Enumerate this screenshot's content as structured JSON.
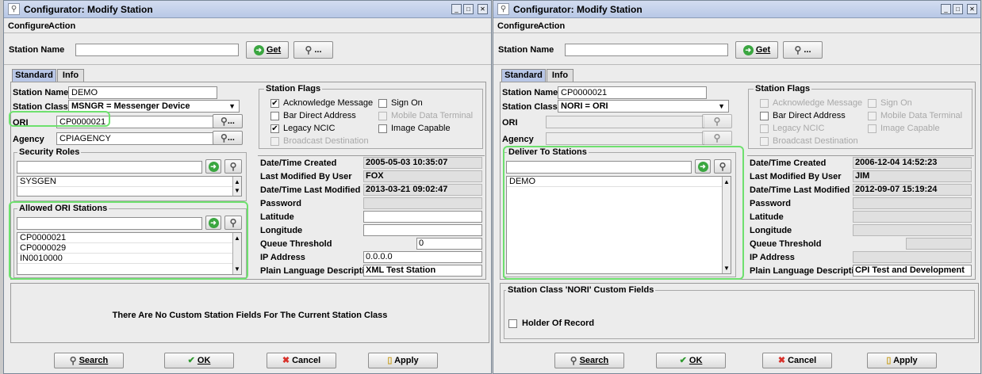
{
  "left": {
    "title": "Configurator: Modify Station",
    "menu": {
      "configure": "Configure",
      "action": "Action"
    },
    "search": {
      "label": "Station Name",
      "value": "",
      "get_label": "Get",
      "browse_label": "..."
    },
    "tabs": {
      "standard": "Standard",
      "info": "Info"
    },
    "form": {
      "station_name_label": "Station Name",
      "station_name_value": "DEMO",
      "station_class_label": "Station Class",
      "station_class_value": "MSNGR = Messenger Device",
      "ori_label": "ORI",
      "ori_value": "CP0000021",
      "agency_label": "Agency",
      "agency_value": "CPIAGENCY",
      "browse_label": "..."
    },
    "security": {
      "title": "Security Roles",
      "input": "",
      "items": [
        "SYSGEN"
      ]
    },
    "allowed": {
      "title": "Allowed ORI Stations",
      "input": "",
      "items": [
        "CP0000021",
        "CP0000029",
        "IN0010000"
      ]
    },
    "flags": {
      "title": "Station Flags",
      "ack": "Acknowledge Message",
      "ack_checked": "✔",
      "bar": "Bar Direct Address",
      "bar_checked": "",
      "legacy": "Legacy NCIC",
      "legacy_checked": "✔",
      "broadcast": "Broadcast Destination",
      "signon": "Sign On",
      "signon_checked": "",
      "mdt": "Mobile Data Terminal",
      "image": "Image Capable",
      "image_checked": ""
    },
    "info": [
      {
        "key": "Date/Time Created",
        "value": "2005-05-03 10:35:07"
      },
      {
        "key": "Last Modified By User",
        "value": "FOX"
      },
      {
        "key": "Date/Time Last Modified",
        "value": "2013-03-21 09:02:47"
      },
      {
        "key": "Password",
        "value": ""
      },
      {
        "key": "Latitude",
        "value": ""
      },
      {
        "key": "Longitude",
        "value": ""
      },
      {
        "key": "Queue Threshold",
        "value": "0"
      },
      {
        "key": "IP Address",
        "value": "0.0.0.0"
      },
      {
        "key": "Plain Language Description",
        "value": "XML Test Station"
      }
    ],
    "custom_message": "There Are No Custom Station Fields For The Current Station Class",
    "buttons": {
      "search": "Search",
      "ok": "OK",
      "cancel": "Cancel",
      "apply": "Apply"
    }
  },
  "right": {
    "title": "Configurator: Modify Station",
    "menu": {
      "configure": "Configure",
      "action": "Action"
    },
    "search": {
      "label": "Station Name",
      "value": "",
      "get_label": "Get",
      "browse_label": "..."
    },
    "tabs": {
      "standard": "Standard",
      "info": "Info"
    },
    "form": {
      "station_name_label": "Station Name",
      "station_name_value": "CP0000021",
      "station_class_label": "Station Class",
      "station_class_value": "NORI = ORI",
      "ori_label": "ORI",
      "ori_value": "",
      "agency_label": "Agency",
      "agency_value": ""
    },
    "deliver": {
      "title": "Deliver To Stations",
      "input": "",
      "items": [
        "DEMO"
      ]
    },
    "flags": {
      "title": "Station Flags",
      "ack": "Acknowledge Message",
      "bar": "Bar Direct Address",
      "bar_checked": "",
      "legacy": "Legacy NCIC",
      "broadcast": "Broadcast Destination",
      "signon": "Sign On",
      "mdt": "Mobile Data Terminal",
      "image": "Image Capable"
    },
    "info": [
      {
        "key": "Date/Time Created",
        "value": "2006-12-04 14:52:23"
      },
      {
        "key": "Last Modified By User",
        "value": "JIM"
      },
      {
        "key": "Date/Time Last Modified",
        "value": "2012-09-07 15:19:24"
      },
      {
        "key": "Password",
        "value": ""
      },
      {
        "key": "Latitude",
        "value": ""
      },
      {
        "key": "Longitude",
        "value": ""
      },
      {
        "key": "Queue Threshold",
        "value": ""
      },
      {
        "key": "IP Address",
        "value": ""
      },
      {
        "key": "Plain Language Description",
        "value": "CPI Test and Development"
      }
    ],
    "custom": {
      "title": "Station Class 'NORI' Custom Fields",
      "holder": "Holder Of Record",
      "holder_checked": ""
    },
    "buttons": {
      "search": "Search",
      "ok": "OK",
      "cancel": "Cancel",
      "apply": "Apply"
    }
  },
  "colors": {
    "highlight": "#6ee06e",
    "title_bar": "#c4d2ec",
    "tab_selected": "#b8c6e6"
  },
  "icons": [
    "station-icon",
    "minimize-icon",
    "maximize-icon",
    "close-icon",
    "green-go-icon",
    "flashlight-icon",
    "dropdown-arrow-icon",
    "checkmark-icon",
    "red-x-icon",
    "page-icon"
  ]
}
